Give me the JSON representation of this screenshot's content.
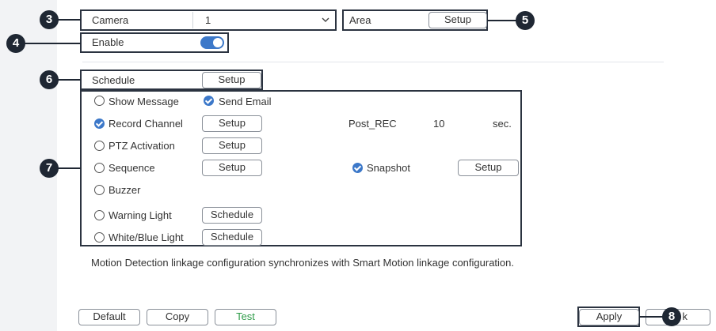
{
  "camera": {
    "label": "Camera",
    "value": "1"
  },
  "area": {
    "label": "Area",
    "button": "Setup"
  },
  "enable": {
    "label": "Enable",
    "on": true
  },
  "schedule": {
    "label": "Schedule",
    "button": "Setup"
  },
  "actions": {
    "show_message": {
      "label": "Show Message",
      "checked": false
    },
    "send_email": {
      "label": "Send Email",
      "checked": true
    },
    "record_channel": {
      "label": "Record Channel",
      "checked": true,
      "button": "Setup"
    },
    "post_rec": {
      "label": "Post_REC",
      "value": "10",
      "unit": "sec."
    },
    "ptz_activation": {
      "label": "PTZ Activation",
      "checked": false,
      "button": "Setup"
    },
    "sequence": {
      "label": "Sequence",
      "checked": false,
      "button": "Setup"
    },
    "snapshot": {
      "label": "Snapshot",
      "checked": true,
      "button": "Setup"
    },
    "buzzer": {
      "label": "Buzzer",
      "checked": false
    },
    "warning_light": {
      "label": "Warning Light",
      "checked": false,
      "button": "Schedule"
    },
    "white_blue_light": {
      "label": "White/Blue Light",
      "checked": false,
      "button": "Schedule"
    }
  },
  "note": "Motion Detection linkage configuration synchronizes with Smart Motion linkage configuration.",
  "footer": {
    "default": "Default",
    "copy": "Copy",
    "test": "Test",
    "apply": "Apply",
    "back": "k"
  },
  "callouts": [
    "3",
    "4",
    "5",
    "6",
    "7",
    "8"
  ],
  "colors": {
    "accent": "#3c78c9",
    "test_text": "#2e9c48",
    "callout": "#1f2733"
  }
}
